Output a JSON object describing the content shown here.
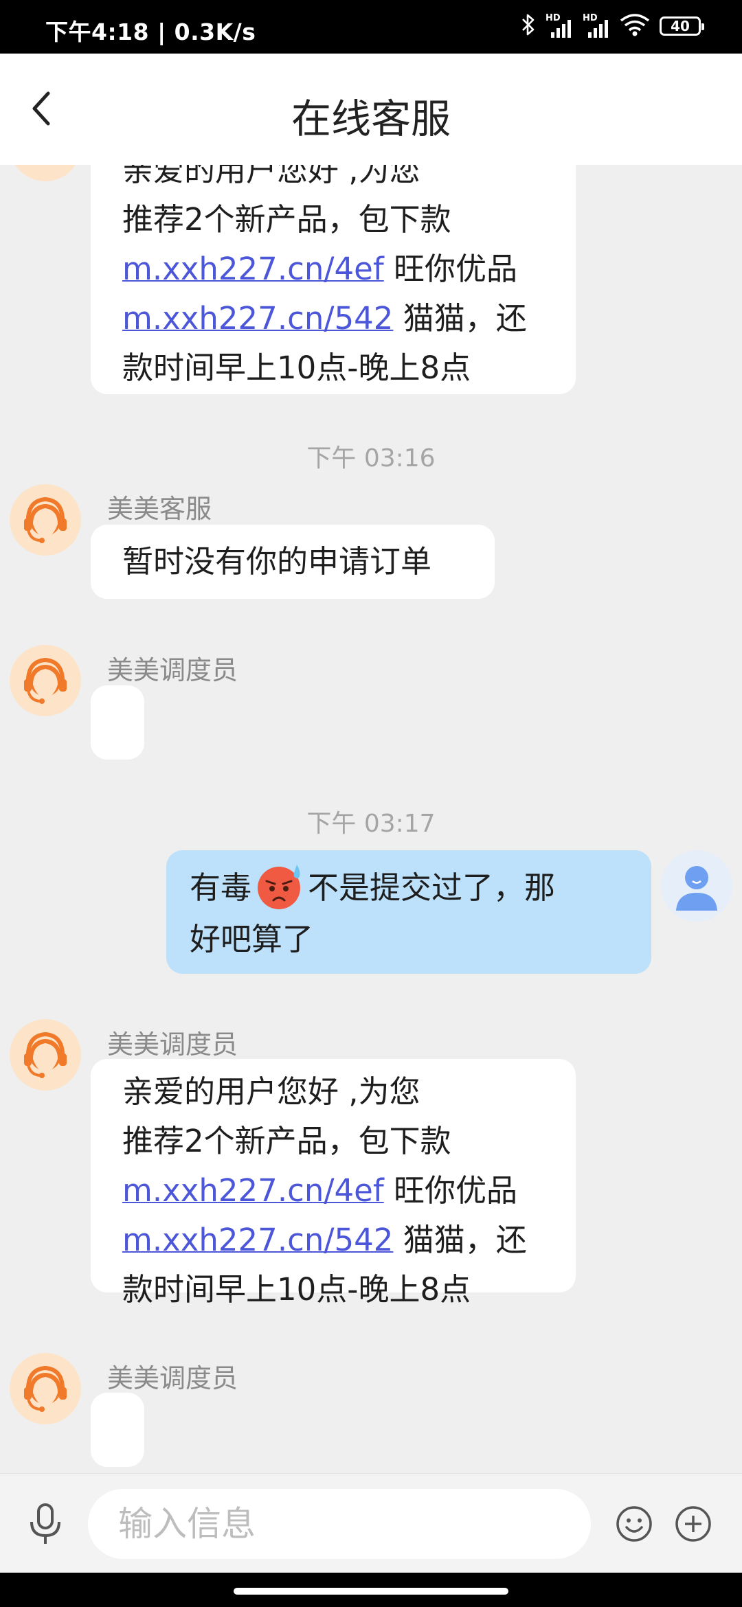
{
  "status_bar": {
    "time_speed": "下午4:18 | 0.3K/s",
    "hd_1": "HD",
    "hd_2": "HD",
    "battery": "40"
  },
  "header": {
    "title": "在线客服"
  },
  "messages": {
    "top_partial": {
      "lines": [
        "亲爱的用户您好 ,为您",
        "推荐2个新产品，包下款"
      ],
      "link1": "m.xxh227.cn/4ef",
      "after_link1": " 旺你优品",
      "link2": "m.xxh227.cn/542",
      "after_link2": " 猫猫，还",
      "last_line": "款时间早上10点-晚上8点"
    },
    "time_1": "下午 03:16",
    "msg_service": {
      "sender": "美美客服",
      "text": "暂时没有你的申请订单"
    },
    "msg_dispatcher_empty_1": {
      "sender": "美美调度员"
    },
    "time_2": "下午 03:17",
    "user_msg": {
      "before_emoji": "有毒",
      "after_emoji": "不是提交过了，那",
      "line2": "好吧算了"
    },
    "msg_dispatcher_promo": {
      "sender": "美美调度员",
      "line1": "亲爱的用户您好 ,为您",
      "line2": "推荐2个新产品，包下款",
      "link1": "m.xxh227.cn/4ef",
      "after_link1": " 旺你优品",
      "link2": "m.xxh227.cn/542",
      "after_link2": " 猫猫，还",
      "line5": "款时间早上10点-晚上8点"
    },
    "msg_dispatcher_empty_2": {
      "sender": "美美调度员"
    }
  },
  "input_bar": {
    "placeholder": "输入信息"
  },
  "colors": {
    "chat_bg": "#efefef",
    "user_bubble": "#bde0fb",
    "link": "#4b56d8",
    "agent_avatar": "#f07a2a"
  },
  "icons": [
    "back-arrow-icon",
    "bluetooth-icon",
    "signal-icon",
    "wifi-icon",
    "battery-icon",
    "agent-headset-avatar",
    "user-avatar",
    "sweat-emoji",
    "microphone-icon",
    "smile-icon",
    "plus-icon"
  ]
}
